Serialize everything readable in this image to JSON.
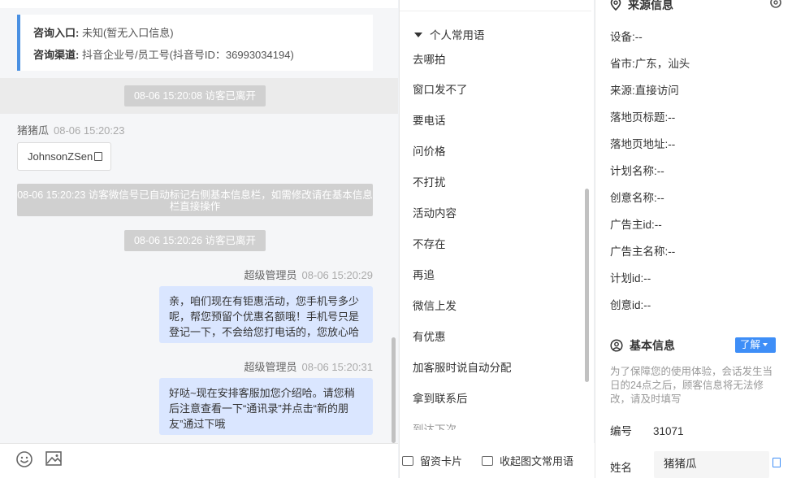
{
  "source_card": {
    "entry_key": "咨询入口:",
    "entry_val": "未知(暂无入口信息)",
    "channel_key": "咨询渠道:",
    "channel_val": "抖音企业号/员工号(抖音号ID：36993034194)"
  },
  "messages": {
    "sys1": "08-06 15:20:08 访客已离开",
    "visitor_name": "猪猪瓜",
    "visitor_time": "08-06 15:20:23",
    "wechat_id": "JohnsonZSen",
    "sys_wide": "08-06 15:20:23 访客微信号已自动标记右侧基本信息栏，如需修改请在基本信息栏直接操作",
    "sys2": "08-06 15:20:26 访客已离开",
    "agent_name": "超级管理员",
    "agent_time1": "08-06 15:20:29",
    "agent_msg1": "亲，咱们现在有钜惠活动，您手机号多少\n呢，帮您预留个优惠名额哦！手机号只是\n登记一下，不会给您打电话的，您放心哈",
    "agent_time2": "08-06 15:20:31",
    "agent_msg2": "好哒~现在安排客服加您介绍哈。请您稍\n后注意查看一下“通讯录”并点击“新的朋\n友”通过下哦"
  },
  "chat_footer": {
    "emoji_icon": "smile-icon",
    "image_icon": "image-icon"
  },
  "phrases": {
    "group_title": "个人常用语",
    "items": [
      "去哪拍",
      "窗口发不了",
      "要电话",
      "问价格",
      "不打扰",
      "活动内容",
      "不存在",
      "再追",
      "微信上发",
      "有优惠",
      "加客服时说自动分配",
      "拿到联系后",
      "到达下次"
    ],
    "footer_card": "留资卡片",
    "footer_collapse": "收起图文常用语"
  },
  "info": {
    "source_title": "来源信息",
    "rows": [
      {
        "k": "设备:",
        "v": "--"
      },
      {
        "k": "省市:",
        "v": "广东，汕头"
      },
      {
        "k": "来源:",
        "v": "直接访问"
      },
      {
        "k": "落地页标题:",
        "v": "--"
      },
      {
        "k": "落地页地址:",
        "v": "--"
      },
      {
        "k": "计划名称:",
        "v": "--"
      },
      {
        "k": "创意名称:",
        "v": "--"
      },
      {
        "k": "广告主id:",
        "v": "--"
      },
      {
        "k": "广告主名称:",
        "v": "--"
      },
      {
        "k": "计划id:",
        "v": "--"
      },
      {
        "k": "创意id:",
        "v": "--"
      }
    ],
    "basic_title": "基本信息",
    "learn_btn": "了解",
    "notice": "为了保障您的使用体验，会话发生当日的24点之后，顾客信息将无法修改，请及时填写",
    "id_key": "编号",
    "id_val": "31071",
    "name_key": "姓名",
    "name_val": "猪猪瓜"
  },
  "colors": {
    "accent": "#3e8ef7",
    "bubble": "#dae6ff",
    "card_border": "#4a90e2"
  }
}
